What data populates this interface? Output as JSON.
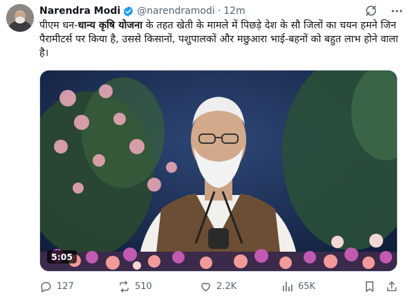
{
  "author": {
    "name": "Narendra Modi",
    "handle": "@narendramodi",
    "separator": "·",
    "time": "12m"
  },
  "tweet": {
    "text_before": "पीएम धन-",
    "text_bold": "धान्य कृषि योजना",
    "text_after": " के तहत खेती के मामले में पिछड़े देश के सौ जिलों का चयन हमने जिन पैरामीटर्स पर किया है, उससे किसानों, पशुपालकों और मछुआरा भाई-बहनों को बहुत लाभ होने वाला है।"
  },
  "media": {
    "duration": "5:05"
  },
  "actions": {
    "replies": "127",
    "reposts": "510",
    "likes": "2.2K",
    "views": "65K"
  },
  "colors": {
    "text": "#0f1419",
    "secondary": "#536471",
    "verified_blue": "#1d9bf0",
    "repost_green": "#00ba7c"
  },
  "icons": [
    "verified-badge-icon",
    "grok-icon",
    "more-icon",
    "reply-icon",
    "repost-icon",
    "like-icon",
    "views-icon",
    "bookmark-icon",
    "share-icon"
  ]
}
